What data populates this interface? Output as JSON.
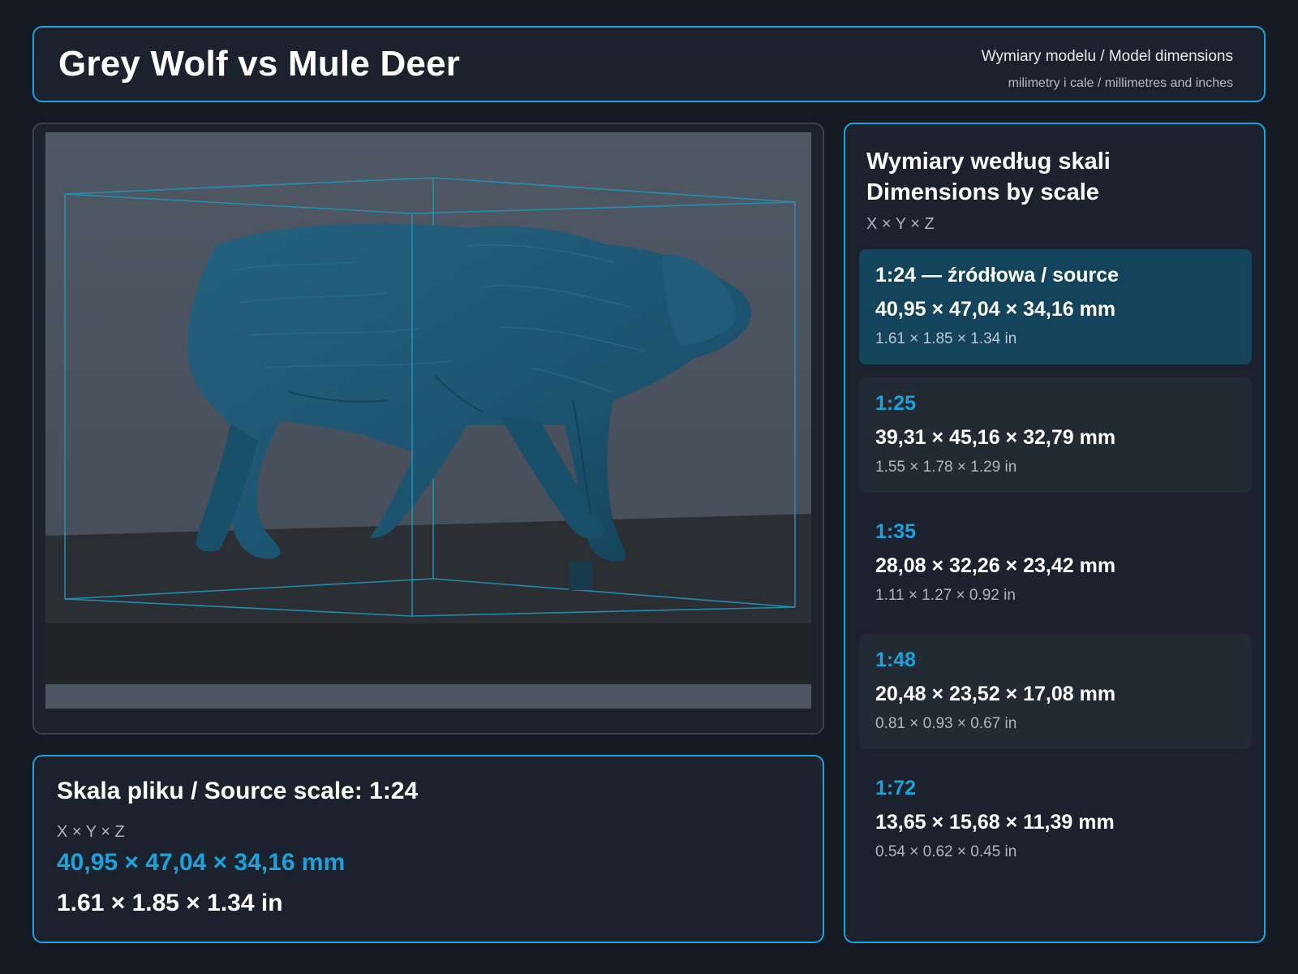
{
  "header": {
    "title": "Grey Wolf vs Mule Deer",
    "subtitle": "Wymiary modelu / Model dimensions",
    "units_note": "milimetry i cale / millimetres and inches"
  },
  "colors": {
    "accent": "#1aa3dc",
    "background": "#131a23",
    "panel": "#1b222d",
    "active_card": "#14435c",
    "model": "#1f5a75"
  },
  "viewer": {
    "model_icon": "wolf-model-icon",
    "bounding_box_icon": "bounding-box-icon"
  },
  "source_scale": {
    "title": "Skala pliku / Source scale: 1:24",
    "axes": "X × Y × Z",
    "mm": "40,95 × 47,04 × 34,16 mm",
    "inches": "1.61 × 1.85 × 1.34 in"
  },
  "scales_panel": {
    "title_pl": "Wymiary według skali",
    "title_en": "Dimensions by scale",
    "axes": "X × Y × Z",
    "scales": [
      {
        "label": "1:24  —  źródłowa / source",
        "mm": "40,95 × 47,04 × 34,16 mm",
        "inches": "1.61 × 1.85 × 1.34 in"
      },
      {
        "label": "1:25",
        "mm": "39,31 × 45,16 × 32,79 mm",
        "inches": "1.55 × 1.78 × 1.29 in"
      },
      {
        "label": "1:35",
        "mm": "28,08 × 32,26 × 23,42 mm",
        "inches": "1.11 × 1.27 × 0.92 in"
      },
      {
        "label": "1:48",
        "mm": "20,48 × 23,52 × 17,08 mm",
        "inches": "0.81 × 0.93 × 0.67 in"
      },
      {
        "label": "1:72",
        "mm": "13,65 × 15,68 × 11,39 mm",
        "inches": "0.54 × 0.62 × 0.45 in"
      }
    ]
  }
}
